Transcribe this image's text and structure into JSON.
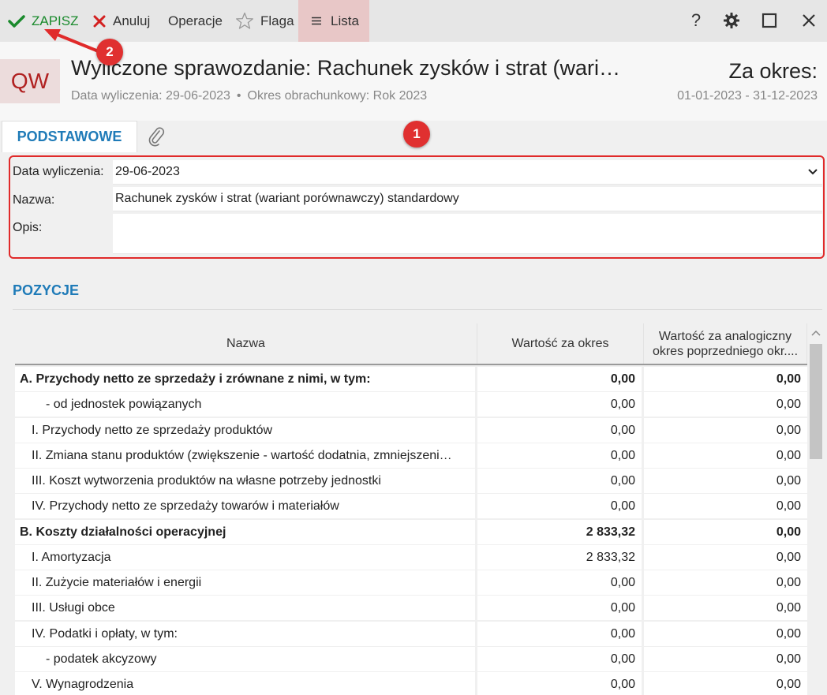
{
  "toolbar": {
    "save_label": "ZAPISZ",
    "cancel_label": "Anuluj",
    "operations_label": "Operacje",
    "flag_label": "Flaga",
    "list_label": "Lista",
    "help_label": "?"
  },
  "header": {
    "badge": "QW",
    "title": "Wyliczone sprawozdanie: Rachunek zysków i strat (wari…",
    "calc_date": "Data wyliczenia: 29-06-2023",
    "separator": "•",
    "period": "Okres obrachunkowy: Rok 2023",
    "za_okres": "Za okres:",
    "range": "01-01-2023 - 31-12-2023"
  },
  "tabs": {
    "basic": "PODSTAWOWE"
  },
  "callouts": {
    "one": "1",
    "two": "2"
  },
  "form": {
    "date_label": "Data wyliczenia:",
    "date_value": "29-06-2023",
    "name_label": "Nazwa:",
    "name_value": "Rachunek zysków i strat (wariant porównawczy) standardowy",
    "desc_label": "Opis:",
    "desc_value": ""
  },
  "section": {
    "title": "POZYCJE"
  },
  "table": {
    "col_name": "Nazwa",
    "col_value": "Wartość za okres",
    "col_prev": "Wartość za analogiczny okres poprzedniego okr....",
    "rows": [
      {
        "name": "A. Przychody netto ze sprzedaży i zrównane z nimi, w tym:",
        "v1": "0,00",
        "v2": "0,00",
        "bold": true
      },
      {
        "name": "  - od jednostek powiązanych",
        "v1": "0,00",
        "v2": "0,00",
        "bold": false
      },
      {
        "name": "I. Przychody netto ze sprzedaży produktów",
        "v1": "0,00",
        "v2": "0,00",
        "bold": false
      },
      {
        "name": "II. Zmiana stanu produktów (zwiększenie - wartość dodatnia, zmniejszeni…",
        "v1": "0,00",
        "v2": "0,00",
        "bold": false
      },
      {
        "name": "III. Koszt wytworzenia produktów na własne potrzeby jednostki",
        "v1": "0,00",
        "v2": "0,00",
        "bold": false
      },
      {
        "name": "IV. Przychody netto ze sprzedaży towarów i materiałów",
        "v1": "0,00",
        "v2": "0,00",
        "bold": false
      },
      {
        "name": "B. Koszty działalności operacyjnej",
        "v1": "2 833,32",
        "v2": "0,00",
        "bold": true
      },
      {
        "name": "I. Amortyzacja",
        "v1": "2 833,32",
        "v2": "0,00",
        "bold": false
      },
      {
        "name": "II. Zużycie materiałów i energii",
        "v1": "0,00",
        "v2": "0,00",
        "bold": false
      },
      {
        "name": "III. Usługi obce",
        "v1": "0,00",
        "v2": "0,00",
        "bold": false
      },
      {
        "name": "IV. Podatki i opłaty, w tym:",
        "v1": "0,00",
        "v2": "0,00",
        "bold": false
      },
      {
        "name": "  - podatek akcyzowy",
        "v1": "0,00",
        "v2": "0,00",
        "bold": false
      },
      {
        "name": "V. Wynagrodzenia",
        "v1": "0,00",
        "v2": "0,00",
        "bold": false
      }
    ]
  },
  "colors": {
    "accent_blue": "#1f7bb8",
    "save_green": "#1a8a2c",
    "callout_red": "#e03030"
  }
}
